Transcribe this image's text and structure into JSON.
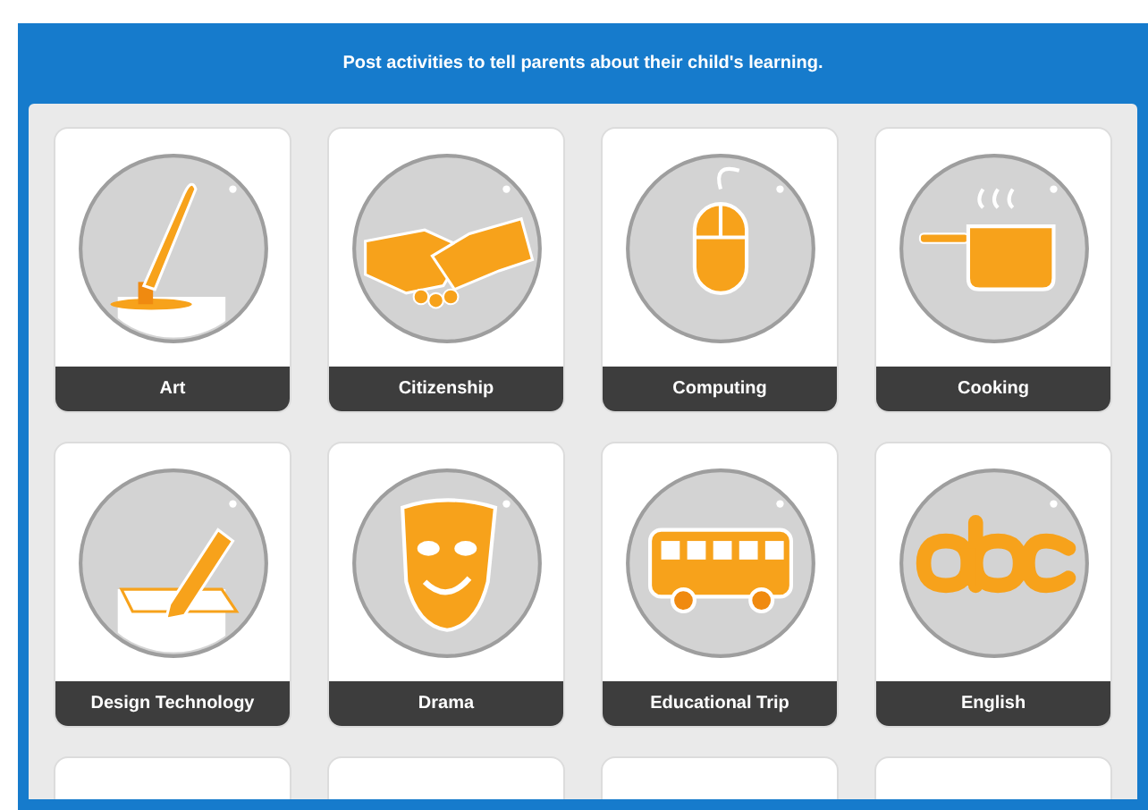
{
  "header": {
    "title": "Post activities to tell parents about their child's learning."
  },
  "activities": [
    {
      "kind": "full",
      "label": "Art"
    },
    {
      "kind": "full",
      "label": "Citizenship"
    },
    {
      "kind": "full",
      "label": "Computing"
    },
    {
      "kind": "full",
      "label": "Cooking"
    },
    {
      "kind": "full",
      "label": "Design Technology"
    },
    {
      "kind": "full",
      "label": "Drama"
    },
    {
      "kind": "full",
      "label": "Educational Trip"
    },
    {
      "kind": "full",
      "label": "English"
    },
    {
      "kind": "cut"
    },
    {
      "kind": "cut"
    },
    {
      "kind": "cut"
    },
    {
      "kind": "cut"
    }
  ]
}
